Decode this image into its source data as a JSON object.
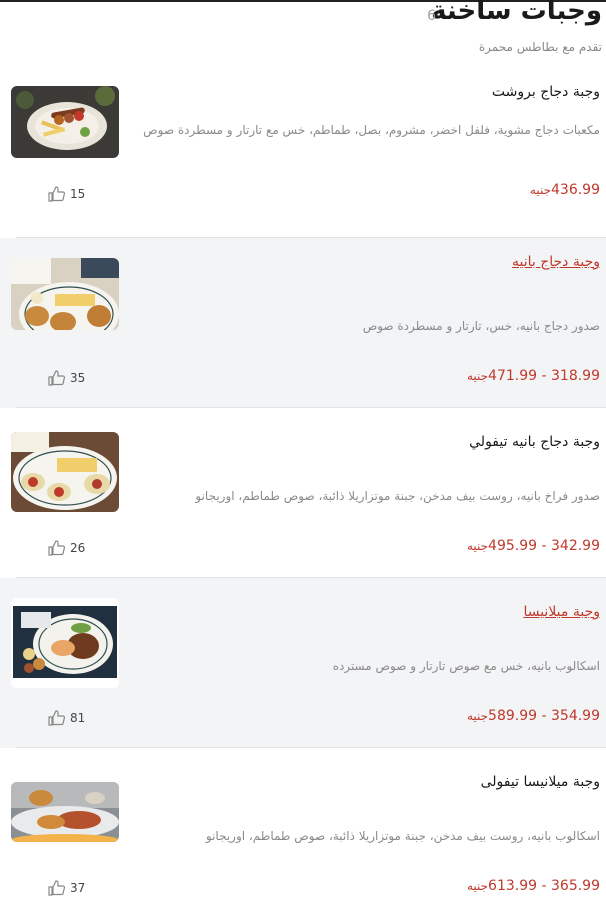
{
  "section": {
    "title": "وجبات ساخنة",
    "count": "6",
    "subtitle": "تقدم مع بطاطس محمرة"
  },
  "currency": "جنيه",
  "items": [
    {
      "name": "وجبة دجاج بروشت",
      "description": "مكعبات دجاج مشوية، فلفل اخضر، مشروم، بصل، طماطم، خس مع تارتار و مسطردة صوص",
      "price": "436.99",
      "likes": "15",
      "linked": false
    },
    {
      "name": "وجبة دجاج بانيه",
      "description": "صدور دجاج بانيه، خس، تارتار و مسطردة صوص",
      "price": "318.99 - 471.99",
      "likes": "35",
      "linked": true
    },
    {
      "name": "وجبة دجاج بانيه تيفولي",
      "description": "صدور فراخ بانيه، روست بيف مدخن، جبنة موتزاريلا ذائبة، صوص طماطم، اوريجانو",
      "price": "342.99 - 495.99",
      "likes": "26",
      "linked": false
    },
    {
      "name": "وجبة ميلانيسا",
      "description": "اسكالوب بانيه، خس مع صوص تارتار و صوص مسترده",
      "price": "354.99 - 589.99",
      "likes": "81",
      "linked": true
    },
    {
      "name": "وجبة ميلانيسا تيفولى",
      "description": "اسكالوب بانيه، روست بيف مدخن، جبنة موتزاريلا ذائبة، صوص طماطم، اوريجانو",
      "price": "365.99 - 613.99",
      "likes": "37",
      "linked": false
    }
  ],
  "colors": {
    "price": "#c0392b",
    "alt_row": "#f3f4f6",
    "muted_text": "#8a8a8a"
  }
}
